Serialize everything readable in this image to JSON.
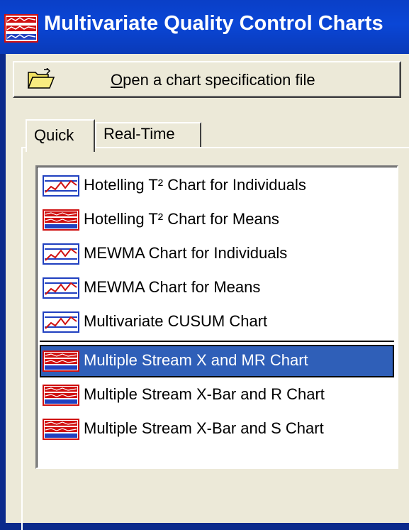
{
  "window": {
    "title": "Multivariate Quality Control Charts",
    "title_bar_color": "#0a46d6",
    "background_color": "#ece9d8"
  },
  "open_button": {
    "label_mnemonic": "O",
    "label_rest": "pen a chart specification file",
    "icon": "folder-open-icon"
  },
  "tabs": [
    {
      "label": "Quick",
      "active": true
    },
    {
      "label": "Real-Time",
      "active": false
    }
  ],
  "chart_list": {
    "items": [
      {
        "label": "Hotelling T² Chart for Individuals",
        "icon": "line-chart-icon",
        "selected": false
      },
      {
        "label": "Hotelling T² Chart for Means",
        "icon": "stacked-chart-icon",
        "selected": false
      },
      {
        "label": "MEWMA Chart for Individuals",
        "icon": "line-chart-icon",
        "selected": false
      },
      {
        "label": "MEWMA Chart for Means",
        "icon": "line-chart-icon",
        "selected": false
      },
      {
        "label": "Multivariate CUSUM Chart",
        "icon": "line-chart-icon",
        "selected": false
      },
      {
        "label": "Multiple Stream X and MR Chart",
        "icon": "stacked-chart-icon",
        "selected": true
      },
      {
        "label": "Multiple Stream X-Bar and R Chart",
        "icon": "stacked-chart-icon",
        "selected": false
      },
      {
        "label": "Multiple Stream X-Bar and S Chart",
        "icon": "stacked-chart-icon",
        "selected": false
      }
    ],
    "selection_color": "#2f5fb8"
  }
}
